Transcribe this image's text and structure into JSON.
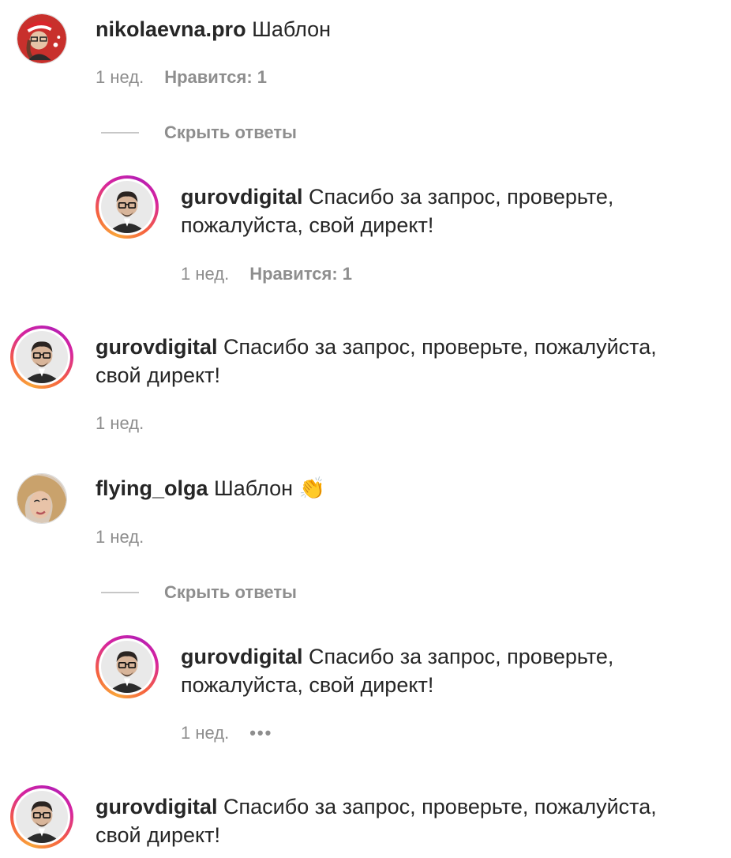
{
  "comments": [
    {
      "username": "nikolaevna.pro",
      "text": "Шаблон",
      "time": "1 нед.",
      "likes": "Нравится: 1",
      "hide_replies": "Скрыть ответы"
    },
    {
      "username": "gurovdigital",
      "text": "Спасибо за запрос, проверьте,",
      "text_line2": "пожалуйста, свой директ!",
      "time": "1 нед.",
      "likes": "Нравится: 1"
    },
    {
      "username": "gurovdigital",
      "text": "Спасибо за запрос, проверьте, пожалуйста,",
      "text_line2": "свой директ!",
      "time": "1 нед."
    },
    {
      "username": "flying_olga",
      "text": "Шаблон 👏",
      "time": "1 нед.",
      "hide_replies": "Скрыть ответы"
    },
    {
      "username": "gurovdigital",
      "text": "Спасибо за запрос, проверьте,",
      "text_line2": "пожалуйста, свой директ!",
      "time": "1 нед.",
      "more": "•••"
    },
    {
      "username": "gurovdigital",
      "text": "Спасибо за запрос, проверьте, пожалуйста,",
      "text_line2": "свой директ!"
    }
  ],
  "colors": {
    "text": "#262626",
    "secondary": "#8e8e8e",
    "story_ring_start": "#f9a43a",
    "story_ring_end": "#d6249f"
  }
}
